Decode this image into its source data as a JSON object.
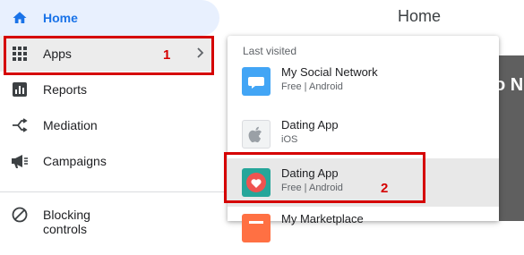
{
  "main": {
    "title": "Home",
    "partial_text": "o N"
  },
  "sidebar": {
    "items": [
      {
        "label": "Home",
        "icon": "home-icon"
      },
      {
        "label": "Apps",
        "icon": "grid-icon"
      },
      {
        "label": "Reports",
        "icon": "reports-icon"
      },
      {
        "label": "Mediation",
        "icon": "mediation-icon"
      },
      {
        "label": "Campaigns",
        "icon": "megaphone-icon"
      },
      {
        "label": "Blocking controls",
        "icon": "block-icon"
      }
    ]
  },
  "apps_menu": {
    "header": "Last visited",
    "apps": [
      {
        "name": "My Social Network",
        "subtitle": "Free | Android",
        "icon": "chat-bubble-icon"
      },
      {
        "name": "Dating App",
        "subtitle": "iOS",
        "icon": "apple-icon"
      },
      {
        "name": "Dating App",
        "subtitle": "Free | Android",
        "icon": "heart-icon"
      },
      {
        "name": "My Marketplace",
        "subtitle": "",
        "icon": "rss-icon"
      }
    ]
  },
  "annotations": {
    "step1": "1",
    "step2": "2"
  },
  "colors": {
    "accent": "#1a73e8",
    "annotation": "#d50000",
    "active_bg": "#e8f0fe"
  }
}
